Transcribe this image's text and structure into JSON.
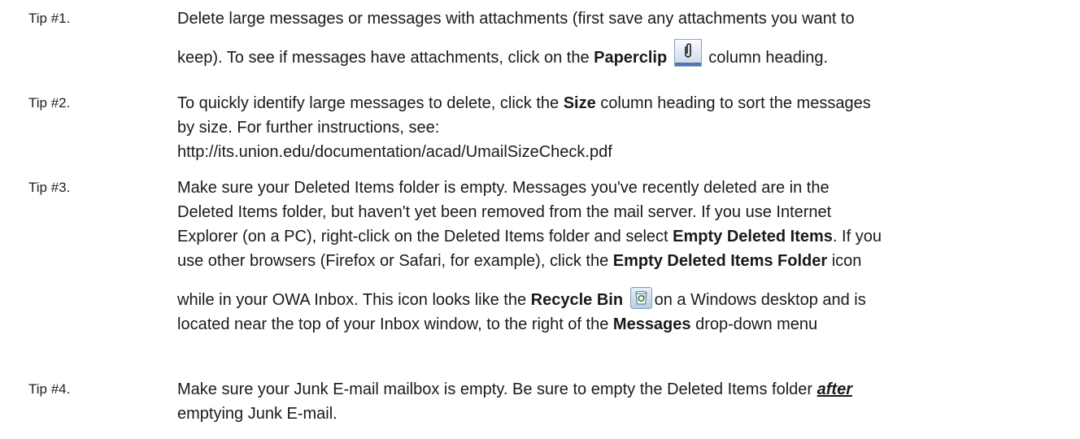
{
  "tips": [
    {
      "label": "Tip #1.",
      "l1": "Delete large messages or messages with attachments (first save any attachments you want to",
      "l2a": "keep). To see if messages have attachments, click on the ",
      "l2b": "Paperclip",
      "l2c": " column heading."
    },
    {
      "label": "Tip #2.",
      "l1a": "To quickly identify large messages to delete, click the ",
      "l1b": "Size",
      "l1c": " column heading to sort the messages",
      "l2": "by size.  For further instructions, see:",
      "l3": "http://its.union.edu/documentation/acad/UmailSizeCheck.pdf"
    },
    {
      "label": "Tip #3.",
      "l1": "Make sure your Deleted Items folder is empty. Messages you've recently deleted are in the",
      "l2": "Deleted Items folder, but haven't yet been removed from the mail server.  If you use Internet",
      "l3a": "Explorer (on a PC), right-click on the Deleted Items folder and select ",
      "l3b": "Empty Deleted Items",
      "l3c": ".  If you",
      "l4a": "use other browsers (Firefox or Safari, for example), click the ",
      "l4b": "Empty Deleted Items Folder",
      "l4c": " icon",
      "l5a": "while in your OWA Inbox. This icon looks like the ",
      "l5b": "Recycle Bin",
      "l5c": "on a Windows desktop and is",
      "l6a": "located near the top of your Inbox window, to the right of the ",
      "l6b": "Messages",
      "l6c": " drop-down menu"
    },
    {
      "label": "Tip #4.",
      "l1a": "Make sure your Junk E-mail mailbox is empty.  Be sure to empty the Deleted Items folder ",
      "l1b": "after",
      "l2": "emptying Junk E-mail."
    }
  ],
  "icons": {
    "paperclip": "paperclip-column-icon",
    "recycle_bin": "recycle-bin-icon"
  },
  "colors": {
    "text": "#1a1a1a",
    "icon_blue": "#4a78b5",
    "icon_green": "#2e8b2e"
  }
}
